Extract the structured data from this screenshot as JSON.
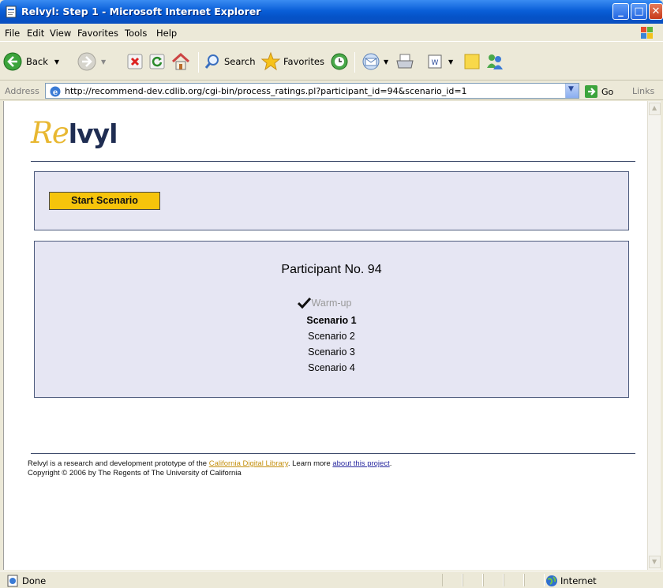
{
  "window": {
    "title": "Relvyl: Step 1 - Microsoft Internet Explorer"
  },
  "menu": [
    "File",
    "Edit",
    "View",
    "Favorites",
    "Tools",
    "Help"
  ],
  "toolbar": {
    "back_label": "Back",
    "search_label": "Search",
    "favorites_label": "Favorites"
  },
  "addressbar": {
    "label": "Address",
    "url": "http://recommend-dev.cdlib.org/cgi-bin/process_ratings.pl?participant_id=94&scenario_id=1",
    "go_label": "Go",
    "links_label": "Links"
  },
  "page": {
    "logo_re": "Re",
    "logo_lvyl": "lvyl",
    "start_button": "Start Scenario",
    "participant_title": "Participant No. 94",
    "steps": [
      {
        "label": "Warm-up",
        "done": true
      },
      {
        "label": "Scenario 1",
        "current": true
      },
      {
        "label": "Scenario 2"
      },
      {
        "label": "Scenario 3"
      },
      {
        "label": "Scenario 4"
      }
    ],
    "footer": {
      "line1_pre": "Relvyl is a research and development prototype of the ",
      "cdl_link": "California Digital Library",
      "line1_mid": ". Learn more ",
      "about_link": "about this project",
      "line1_post": ".",
      "line2": "Copyright © 2006 by The Regents of The University of California"
    }
  },
  "statusbar": {
    "status": "Done",
    "zone": "Internet"
  },
  "colors": {
    "accent_button": "#f6c40b",
    "panel_bg": "#e6e6f3",
    "logo_re": "#e8b730",
    "logo_lvyl": "#1f2d52",
    "titlebar": "#0553c8"
  }
}
